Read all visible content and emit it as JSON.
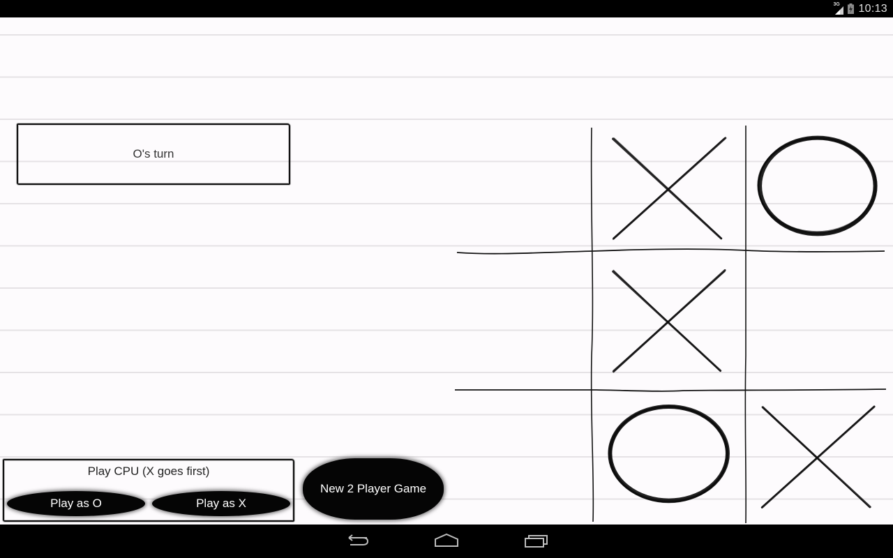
{
  "status_bar": {
    "network_label": "3G",
    "time": "10:13",
    "icons": [
      "signal-icon",
      "battery-icon"
    ]
  },
  "game": {
    "turn_text": "O's turn",
    "current_player": "O",
    "board": [
      [
        "",
        "X",
        "O"
      ],
      [
        "",
        "X",
        ""
      ],
      [
        "",
        "O",
        "X"
      ]
    ]
  },
  "cpu_panel": {
    "title": "Play CPU (X goes first)",
    "play_as_o_label": "Play as O",
    "play_as_x_label": "Play as X"
  },
  "new_game_label": "New 2 Player Game",
  "nav_bar": {
    "icons": [
      "back-icon",
      "home-icon",
      "recent-apps-icon"
    ]
  },
  "colors": {
    "paper": "#fdfbfd",
    "ink": "#0a0a0a",
    "bars": "#000000",
    "ruled_line": "#c8c4c8"
  }
}
